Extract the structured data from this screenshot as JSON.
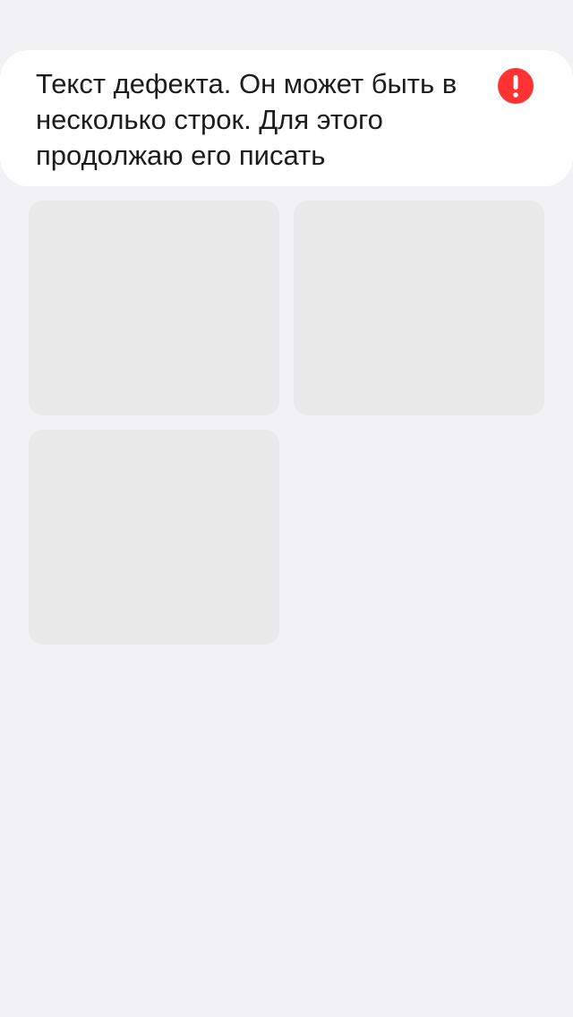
{
  "defect": {
    "text": "Текст дефекта. Он может быть в несколько строк. Для этого продолжаю его писать",
    "status_icon": "alert-exclamation-icon",
    "status_color": "#ff3333"
  },
  "colors": {
    "background": "#f2f2f4",
    "card": "#ffffff",
    "photo_placeholder": "#e9e9ea"
  },
  "photos": [
    {
      "state": "placeholder"
    },
    {
      "state": "placeholder"
    },
    {
      "state": "placeholder"
    }
  ]
}
